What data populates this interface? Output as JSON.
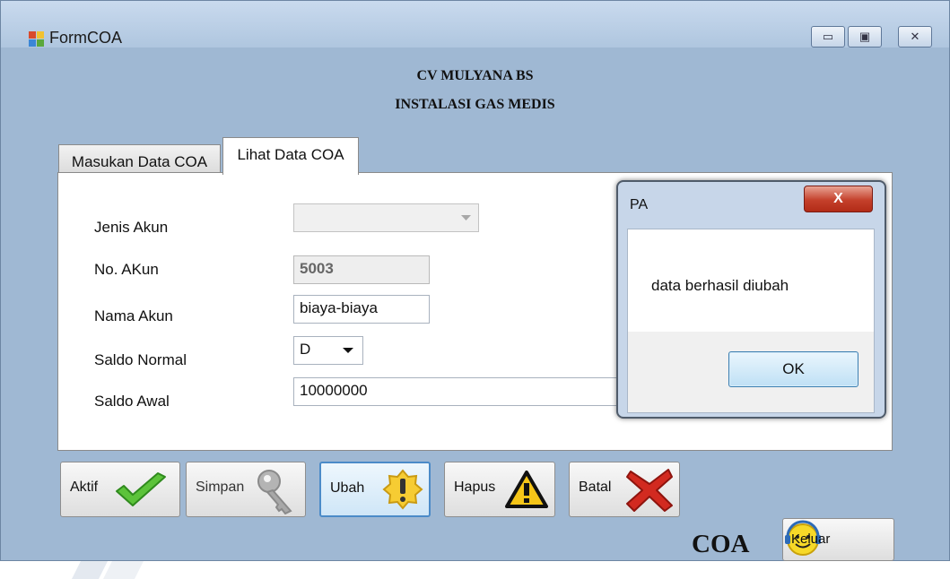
{
  "window": {
    "title": "FormCOA",
    "minimize": "▭",
    "maximize": "▣",
    "close": "✕"
  },
  "header": {
    "company": "CV MULYANA BS",
    "subtitle": "INSTALASI GAS MEDIS"
  },
  "tabs": [
    {
      "label": "Masukan Data COA",
      "active": false
    },
    {
      "label": "Lihat Data COA",
      "active": true
    }
  ],
  "form": {
    "jenis_akun": {
      "label": "Jenis Akun",
      "value": ""
    },
    "no_akun": {
      "label": "No. AKun",
      "value": "5003"
    },
    "nama_akun": {
      "label": "Nama Akun",
      "value": "biaya-biaya"
    },
    "saldo_normal": {
      "label": "Saldo Normal",
      "value": "D"
    },
    "saldo_awal": {
      "label": "Saldo Awal",
      "value": "10000000"
    }
  },
  "buttons": {
    "aktif": "Aktif",
    "simpan": "Simpan",
    "ubah": "Ubah",
    "hapus": "Hapus",
    "batal": "Batal",
    "keluar": "Keluar"
  },
  "footer_label": "COA",
  "dialog": {
    "title": "PA",
    "message": "data berhasil diubah",
    "ok": "OK",
    "close": "X"
  },
  "colors": {
    "form_bg": "#9fb8d3",
    "ok_border": "#3c7fb1",
    "close_red": "#c4402b"
  },
  "icons": [
    "app-icon",
    "check-icon",
    "key-icon",
    "warning-badge-icon",
    "warning-triangle-icon",
    "red-x-icon",
    "smiley-headset-icon"
  ]
}
